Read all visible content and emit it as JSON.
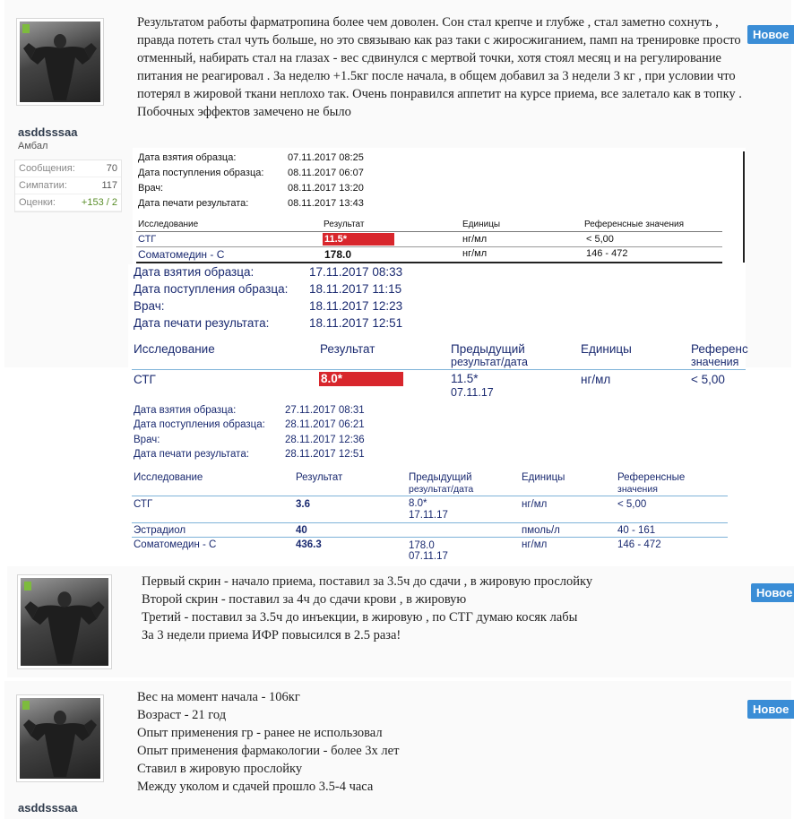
{
  "posts": [
    {
      "user": {
        "name": "asddsssaa",
        "title": "Амбал"
      },
      "stats": [
        {
          "label": "Сообщения:",
          "value": "70"
        },
        {
          "label": "Симпатии:",
          "value": "117"
        },
        {
          "label": "Оценки:",
          "value": "+153 / 2"
        }
      ],
      "badge": "Новое",
      "text": "Результатом работы фарматропина более чем доволен. Сон стал крепче и глубже , стал заметно сохнуть , правда потеть стал чуть больше, но это связываю как раз таки с жиросжиганием, памп на тренировке просто отменный, набирать стал на глазах - вес сдвинулся с мертвой точки, хотя стоял месяц и на регулирование питания не реагировал . За неделю +1.5кг после начала, в общем добавил за 3 недели 3 кг , при условии что потерял в жировой ткани неплохо так. Очень понравился аппетит на курсе приема, все залетало как в топку . Побочных эффектов замечено не было"
    },
    {
      "badge": "Новое",
      "lines": [
        "Первый скрин - начало приема, поставил за 3.5ч до сдачи , в жировую прослойку",
        "Второй скрин - поставил за 4ч до сдачи крови , в жировую",
        "Третий - поставил за 3.5ч до инъекции, в жировую , по СТГ думаю косяк лабы",
        "За 3 недели приема ИФР повысился в 2.5 раза!"
      ]
    },
    {
      "user": {
        "name": "asddsssaa"
      },
      "badge": "Новое",
      "lines": [
        "Вес на момент начала - 106кг",
        "Возраст - 21 год",
        "Опыт применения гр - ранее не использовал",
        "Опыт применения фармакологии - более 3х лет",
        "Ставил в жировую прослойку",
        "Между уколом и сдачей прошло 3.5-4 часа"
      ]
    }
  ],
  "scan1": {
    "meta": [
      {
        "k": "Дата взятия образца:",
        "v": "07.11.2017 08:25"
      },
      {
        "k": "Дата поступления образца:",
        "v": "08.11.2017 06:07"
      },
      {
        "k": "Врач:",
        "v": "08.11.2017 13:20"
      },
      {
        "k": "Дата печати результата:",
        "v": "08.11.2017 13:43"
      }
    ],
    "headers": [
      "Исследование",
      "Результат",
      "Единицы",
      "Референсные значения"
    ],
    "rows": [
      {
        "name": "СТГ",
        "result": "11.5*",
        "unit": "нг/мл",
        "ref": "< 5,00"
      },
      {
        "name": "Соматомедин - С",
        "result": "178.0",
        "unit": "нг/мл",
        "ref": "146 - 472"
      }
    ]
  },
  "scan2": {
    "meta": [
      {
        "k": "Дата взятия образца:",
        "v": "17.11.2017 08:33"
      },
      {
        "k": "Дата поступления образца:",
        "v": "18.11.2017 11:15"
      },
      {
        "k": "Врач:",
        "v": "18.11.2017 12:23"
      },
      {
        "k": "Дата печати результата:",
        "v": "18.11.2017 12:51"
      }
    ],
    "headers": {
      "study": "Исследование",
      "result": "Результат",
      "prev1": "Предыдущий",
      "prev2": "результат/дата",
      "unit": "Единицы",
      "ref1": "Референс",
      "ref2": "значения"
    },
    "row": {
      "name": "СТГ",
      "result": "8.0*",
      "prev1": "11.5*",
      "prev2": "07.11.17",
      "unit": "нг/мл",
      "ref": "< 5,00"
    }
  },
  "scan3": {
    "meta": [
      {
        "k": "Дата взятия образца:",
        "v": "27.11.2017 08:31"
      },
      {
        "k": "Дата поступления образца:",
        "v": "28.11.2017 06:21"
      },
      {
        "k": "Врач:",
        "v": "28.11.2017 12:36"
      },
      {
        "k": "Дата печати результата:",
        "v": "28.11.2017 12:51"
      }
    ],
    "headers": {
      "study": "Исследование",
      "result": "Результат",
      "prev1": "Предыдущий",
      "prev2": "результат/дата",
      "unit": "Единицы",
      "ref1": "Референсные",
      "ref2": "значения"
    },
    "rows": [
      {
        "name": "СТГ",
        "result": "3.6",
        "prev1": "8.0*",
        "prev2": "17.11.17",
        "unit": "нг/мл",
        "ref": "< 5,00"
      },
      {
        "name": "Эстрадиол",
        "result": "40",
        "prev1": "",
        "prev2": "",
        "unit": "пмоль/л",
        "ref": "40 - 161"
      },
      {
        "name": "Соматомедин - С",
        "result": "436.3",
        "prev1": "178.0",
        "prev2": "07.11.17",
        "unit": "нг/мл",
        "ref": "146 - 472"
      }
    ]
  },
  "colors": {
    "badge": "#3a8dd6",
    "online": "#7dbb3d",
    "red": "#d8262c",
    "navy": "#1a2a70"
  }
}
